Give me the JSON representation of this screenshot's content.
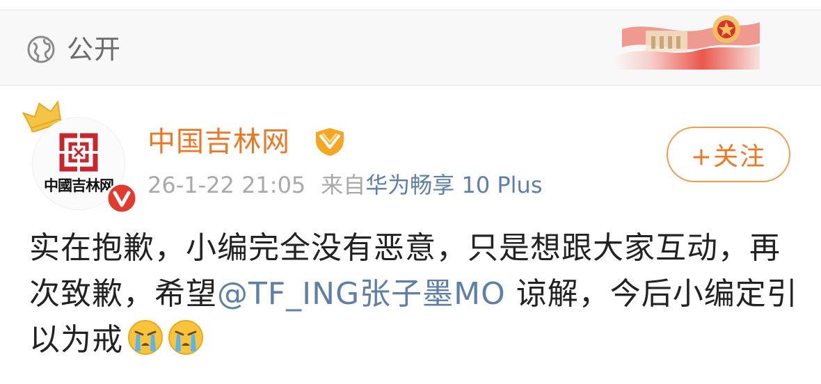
{
  "visibility": {
    "label": "公开",
    "icon": "globe-icon"
  },
  "banner": {
    "icon": "red-flag-banner"
  },
  "account": {
    "name": "中国吉林网",
    "avatar_text": "中國吉林网",
    "badges": [
      "crown-icon",
      "vip-badge-icon",
      "verified-v-icon"
    ]
  },
  "post": {
    "date": "26-1-22 21:05",
    "source_prefix": "来自",
    "source_device": "华为畅享 10 Plus",
    "text_part1": "实在抱歉，小编完全没有恶意，只是想跟大家互动，再次致歉，希望",
    "mention": "@TF_ING张子墨MO",
    "text_part2": " 谅解，今后小编定引以为戒",
    "emojis": [
      "crying-face-icon",
      "crying-face-icon"
    ]
  },
  "follow_button": {
    "label": "+关注"
  },
  "colors": {
    "accent": "#ef7622",
    "link": "#5e7fa7",
    "meta": "#a9a9a9"
  }
}
